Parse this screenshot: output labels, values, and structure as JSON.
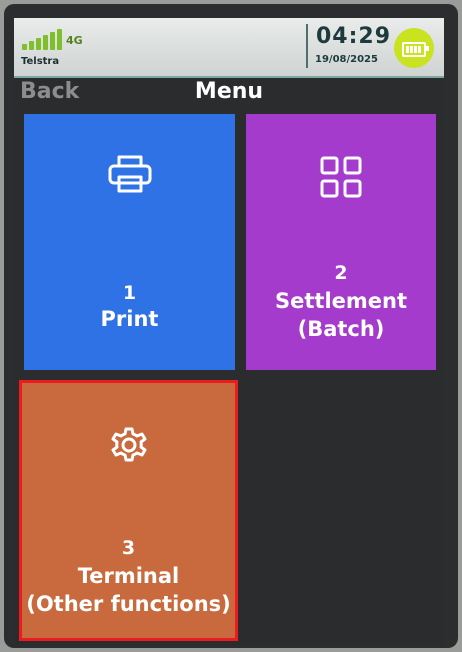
{
  "status_bar": {
    "network": "4G",
    "carrier": "Telstra",
    "time": "04:29",
    "date": "19/08/2025",
    "icons": {
      "signal": "signal-bars-icon",
      "battery": "battery-full-icon"
    }
  },
  "nav": {
    "back": "Back",
    "title": "Menu"
  },
  "tiles": [
    {
      "number": "1",
      "label": "Print",
      "icon": "printer-icon",
      "color": "#2f72e6"
    },
    {
      "number": "2",
      "label": "Settlement",
      "label2": "(Batch)",
      "icon": "grid-icon",
      "color": "#a43bcd"
    },
    {
      "number": "3",
      "label": "Terminal",
      "label2": "(Other functions)",
      "icon": "gear-icon",
      "color": "#c86a3e"
    }
  ],
  "highlight_color": "#ec1b1f"
}
